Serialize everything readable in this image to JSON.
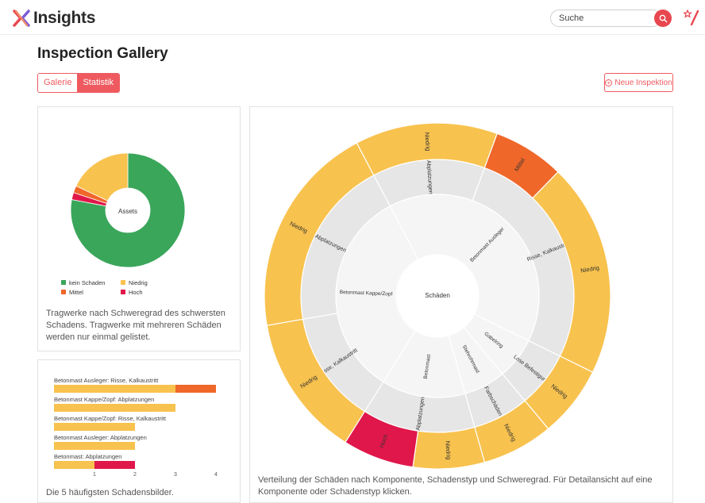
{
  "app": {
    "title": "Insights"
  },
  "search": {
    "placeholder": "Suche"
  },
  "page": {
    "title": "Inspection Gallery"
  },
  "tabs": [
    {
      "label": "Galerie",
      "active": false
    },
    {
      "label": "Statistik",
      "active": true
    }
  ],
  "actions": {
    "new_inspection": "Neue Inspektion"
  },
  "colors": {
    "accent": "#ee5a5f",
    "kein_schaden": "#3aa65a",
    "niedrig": "#f8c24e",
    "mittel": "#f0672a",
    "hoch": "#e0174a",
    "inner_ring": "#e6e6e6",
    "center": "#f5f5f5"
  },
  "icons": {
    "logo": "x-logo-icon",
    "search": "search-icon",
    "favorite": "star-pen-icon",
    "new": "plus-circle-icon"
  },
  "assets_chart": {
    "center_label": "Assets",
    "legend": [
      {
        "label": "kein Schaden",
        "key": "kein_schaden"
      },
      {
        "label": "Niedrig",
        "key": "niedrig"
      },
      {
        "label": "Mittel",
        "key": "mittel"
      },
      {
        "label": "Hoch",
        "key": "hoch"
      }
    ],
    "description": "Tragwerke nach Schweregrad des schwersten Schadens. Tragwerke mit mehreren Schäden werden nur einmal gelistet."
  },
  "bars_chart": {
    "description": "Die 5 häufigsten Schadensbilder.",
    "ticks": [
      "1",
      "2",
      "3",
      "4"
    ]
  },
  "sunburst": {
    "center": "Schäden",
    "description": "Verteilung der Schäden nach Komponente, Schadenstyp und Schweregrad. Für Detailansicht auf eine Komponente oder Schadenstyp klicken."
  },
  "chart_data": [
    {
      "type": "pie",
      "title": "Assets",
      "categories": [
        "kein Schaden",
        "Hoch",
        "Mittel",
        "Niedrig"
      ],
      "values": [
        78,
        2,
        2,
        18
      ]
    },
    {
      "type": "bar",
      "orientation": "horizontal",
      "categories": [
        "Betonmast Ausleger: Risse, Kalkaustritt",
        "Betonmast Kappe/Zopf: Abplatzungen",
        "Betonmast Kappe/Zopf: Risse, Kalkaustritt",
        "Betonmast Ausleger: Abplatzungen",
        "Betonmast: Abplatzungen"
      ],
      "series": [
        {
          "name": "Niedrig",
          "values": [
            3,
            3,
            2,
            2,
            1
          ]
        },
        {
          "name": "Mittel",
          "values": [
            1,
            0,
            0,
            0,
            0
          ]
        },
        {
          "name": "Hoch",
          "values": [
            0,
            0,
            0,
            0,
            1
          ]
        }
      ],
      "xlim": [
        0,
        4
      ],
      "xticks": [
        1,
        2,
        3,
        4
      ]
    },
    {
      "type": "sunburst",
      "center": "Schäden",
      "components": [
        {
          "label": "Betonmast Ausleger",
          "types": [
            {
              "label": "Abplatzungen",
              "severity": [
                {
                  "label": "Niedrig",
                  "value": 2
                }
              ]
            },
            {
              "label": "Risse, Kalkaustritt",
              "severity": [
                {
                  "label": "Mittel",
                  "value": 1
                },
                {
                  "label": "Niedrig",
                  "value": 3
                }
              ]
            }
          ]
        },
        {
          "label": "Gabelring",
          "types": [
            {
              "label": "Lose Befestigung",
              "severity": [
                {
                  "label": "Niedrig",
                  "value": 1
                }
              ]
            }
          ]
        },
        {
          "label": "Stehrohrmast",
          "types": [
            {
              "label": "Farbschäden",
              "severity": [
                {
                  "label": "Niedrig",
                  "value": 1
                }
              ]
            }
          ]
        },
        {
          "label": "Betonmast",
          "types": [
            {
              "label": "Abplatzungen",
              "severity": [
                {
                  "label": "Niedrig",
                  "value": 1
                },
                {
                  "label": "Hoch",
                  "value": 1
                }
              ]
            }
          ]
        },
        {
          "label": "Betonmast Kappe/Zopf",
          "types": [
            {
              "label": "Risse, Kalkaustritt",
              "severity": [
                {
                  "label": "Niedrig",
                  "value": 2
                }
              ]
            },
            {
              "label": "Abplatzungen",
              "severity": [
                {
                  "label": "Niedrig",
                  "value": 3
                }
              ]
            }
          ]
        }
      ]
    }
  ]
}
